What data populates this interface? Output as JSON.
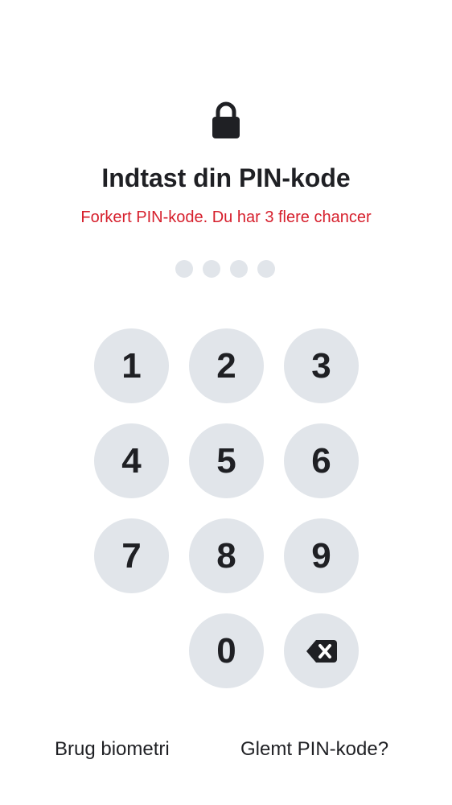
{
  "header": {
    "lock_icon": "lock-icon",
    "title": "Indtast din PIN-kode",
    "error_message": "Forkert PIN-kode. Du har 3 flere chancer",
    "error_color": "#d61f2c"
  },
  "pin": {
    "length": 4,
    "entered": 0
  },
  "keypad": {
    "keys": [
      "1",
      "2",
      "3",
      "4",
      "5",
      "6",
      "7",
      "8",
      "9",
      "0"
    ],
    "backspace_icon": "backspace-icon",
    "key_color": "#e1e5ea"
  },
  "footer": {
    "biometrics_label": "Brug biometri",
    "forgot_label": "Glemt PIN-kode?"
  }
}
